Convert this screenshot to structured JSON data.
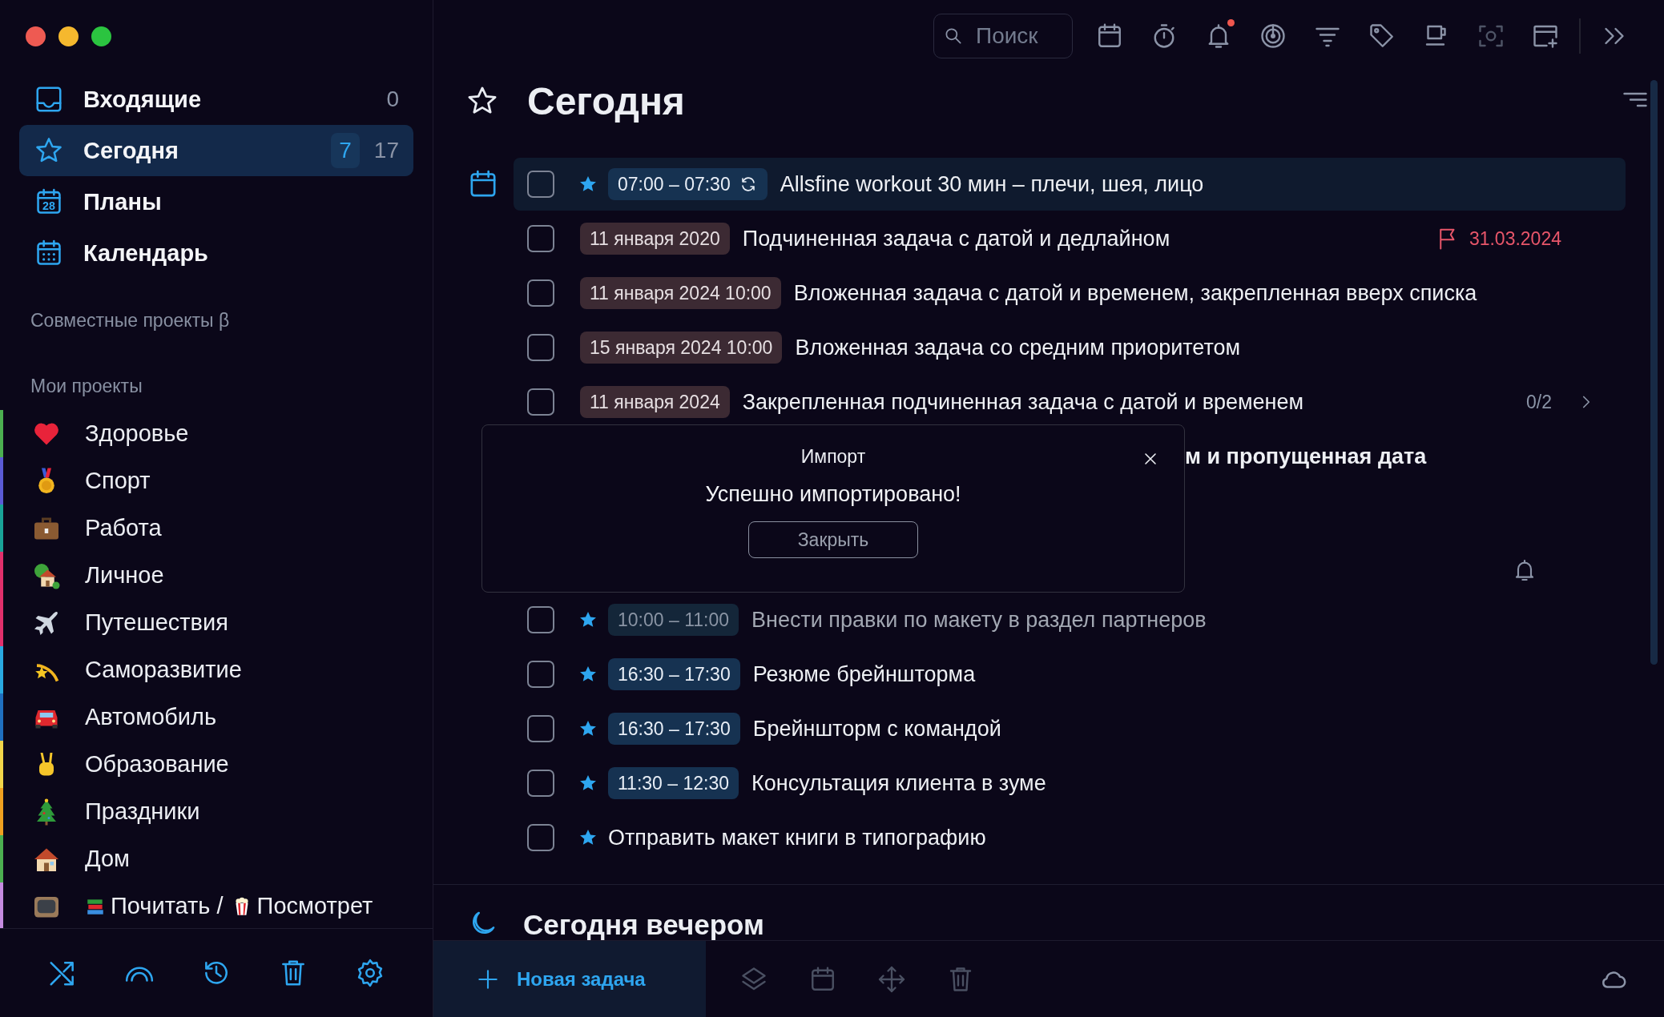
{
  "sidebar": {
    "nav": [
      {
        "label": "Входящие",
        "selected": false,
        "counts": [
          {
            "text": "0",
            "boxed": false
          }
        ]
      },
      {
        "label": "Сегодня",
        "selected": true,
        "counts": [
          {
            "text": "7",
            "boxed": true
          },
          {
            "text": "17",
            "boxed": false
          }
        ]
      },
      {
        "label": "Планы",
        "icon_text": "28",
        "selected": false
      },
      {
        "label": "Календарь",
        "selected": false
      }
    ],
    "shared_header": "Совместные проекты β",
    "projects_header": "Мои проекты",
    "projects": [
      {
        "color": "#4caf50",
        "parts": [
          {
            "kind": "icon"
          },
          {
            "kind": "text",
            "text": "Здоровье"
          }
        ]
      },
      {
        "color": "#5b5bd6",
        "parts": [
          {
            "kind": "icon"
          },
          {
            "kind": "text",
            "text": "Спорт"
          }
        ]
      },
      {
        "color": "#19a398",
        "parts": [
          {
            "kind": "icon"
          },
          {
            "kind": "text",
            "text": "Работа"
          }
        ]
      },
      {
        "color": "#e2306c",
        "parts": [
          {
            "kind": "icon"
          },
          {
            "kind": "text",
            "text": "Личное"
          }
        ]
      },
      {
        "color": "#e2306c",
        "parts": [
          {
            "kind": "icon"
          },
          {
            "kind": "text",
            "text": "Путешествия"
          }
        ]
      },
      {
        "color": "#29a9e1",
        "parts": [
          {
            "kind": "icon"
          },
          {
            "kind": "text",
            "text": "Саморазвитие"
          }
        ]
      },
      {
        "color": "#1f6fbf",
        "parts": [
          {
            "kind": "icon"
          },
          {
            "kind": "text",
            "text": "Автомобиль"
          }
        ]
      },
      {
        "color": "#f2d54a",
        "parts": [
          {
            "kind": "icon"
          },
          {
            "kind": "text",
            "text": "Образование"
          }
        ]
      },
      {
        "color": "#f0a020",
        "parts": [
          {
            "kind": "icon"
          },
          {
            "kind": "text",
            "text": "Праздники"
          }
        ]
      },
      {
        "color": "#4caf50",
        "parts": [
          {
            "kind": "icon"
          },
          {
            "kind": "text",
            "text": "Дом"
          }
        ]
      },
      {
        "color": "#c58be0",
        "parts": [
          {
            "kind": "icon"
          },
          {
            "kind": "icon"
          },
          {
            "kind": "text",
            "text": "Почитать /"
          },
          {
            "kind": "icon"
          },
          {
            "kind": "text",
            "text": "Посмотрет"
          }
        ]
      }
    ]
  },
  "toolbar": {
    "search": {
      "placeholder": "Поиск"
    },
    "tools": [
      {
        "badge": false,
        "disabled": false
      },
      {
        "badge": false,
        "disabled": false
      },
      {
        "badge": true,
        "disabled": false
      },
      {
        "badge": false,
        "disabled": false
      },
      {
        "badge": false,
        "disabled": false
      },
      {
        "badge": false,
        "disabled": false
      },
      {
        "badge": false,
        "disabled": false
      },
      {
        "badge": false,
        "disabled": true
      },
      {
        "badge": false,
        "disabled": false
      }
    ]
  },
  "main": {
    "title": "Сегодня",
    "tasks": [
      {
        "kind": "task",
        "selected": true,
        "checked": false,
        "starred": true,
        "tag": {
          "text": "07:00 – 07:30",
          "kind": "time"
        },
        "repeat": true,
        "title": "Allsfine workout 30 мин – плечи, шея, лицо",
        "faded": false,
        "emphasized": false
      },
      {
        "kind": "task",
        "selected": false,
        "checked": false,
        "starred": false,
        "tag": {
          "text": "11 января 2020",
          "kind": "date"
        },
        "repeat": false,
        "title": "Подчиненная задача с датой и дедлайном",
        "deadline": "31.03.2024",
        "faded": false,
        "emphasized": false
      },
      {
        "kind": "task",
        "selected": false,
        "checked": false,
        "starred": false,
        "tag": {
          "text": "11 января 2024 10:00",
          "kind": "date"
        },
        "repeat": false,
        "title": "Вложенная задача с датой и временем, закрепленная вверх списка",
        "faded": false,
        "emphasized": false
      },
      {
        "kind": "task",
        "selected": false,
        "checked": false,
        "starred": false,
        "tag": {
          "text": "15 января 2024 10:00",
          "kind": "date"
        },
        "repeat": false,
        "title": "Вложенная задача со средним приоритетом",
        "faded": false,
        "emphasized": false
      },
      {
        "kind": "task",
        "selected": false,
        "checked": false,
        "starred": false,
        "tag": {
          "text": "11 января 2024",
          "kind": "date"
        },
        "repeat": false,
        "title": "Закрепленная подчиненная задача с датой и временем",
        "progress": "0/2",
        "expanded": false,
        "faded": false,
        "emphasized": false
      },
      {
        "kind": "covered",
        "selected": false,
        "title": "м и пропущенная дата",
        "faded": false,
        "emphasized": true
      },
      {
        "kind": "covered",
        "selected": false,
        "reminder": true
      },
      {
        "kind": "task",
        "selected": false,
        "checked": false,
        "starred": true,
        "tag": {
          "text": "10:00 – 11:00",
          "kind": "time"
        },
        "repeat": false,
        "title": "Внести правки по макету в раздел партнеров",
        "faded": true,
        "emphasized": false
      },
      {
        "kind": "task",
        "selected": false,
        "checked": false,
        "starred": true,
        "tag": {
          "text": "16:30 – 17:30",
          "kind": "time"
        },
        "repeat": false,
        "title": "Резюме брейншторма",
        "faded": false,
        "emphasized": false
      },
      {
        "kind": "task",
        "selected": false,
        "checked": false,
        "starred": true,
        "tag": {
          "text": "16:30 – 17:30",
          "kind": "time"
        },
        "repeat": false,
        "title": "Брейншторм с командой",
        "faded": false,
        "emphasized": false
      },
      {
        "kind": "task",
        "selected": false,
        "checked": false,
        "starred": true,
        "tag": {
          "text": "11:30 – 12:30",
          "kind": "time"
        },
        "repeat": false,
        "title": "Консультация клиента в зуме",
        "faded": false,
        "emphasized": false
      },
      {
        "kind": "task",
        "selected": false,
        "checked": false,
        "starred": true,
        "title": "Отправить макет книги в типографию",
        "faded": false,
        "emphasized": false
      }
    ],
    "section": {
      "title": "Сегодня вечером"
    },
    "dialog": {
      "title": "Импорт",
      "message": "Успешно импортировано!",
      "button": "Закрыть"
    },
    "bottom_bar": {
      "new_task": "Новая задача",
      "actions": [
        {
          "disabled": true
        },
        {
          "disabled": true
        },
        {
          "disabled": true
        },
        {
          "disabled": true
        }
      ]
    }
  }
}
